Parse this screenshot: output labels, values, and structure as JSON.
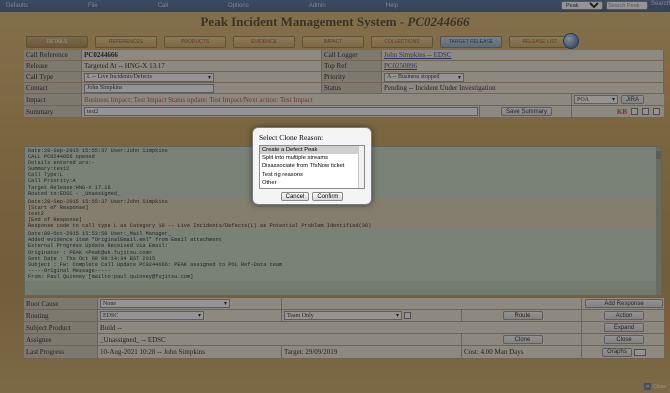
{
  "menubar": {
    "items": [
      "Defaults",
      "File",
      "Call",
      "Options",
      "Admin",
      "Help"
    ],
    "scope_value": "Peak",
    "search_placeholder": "Search Peak",
    "search_label": "Search"
  },
  "app": {
    "title": "Peak Incident Management System - ",
    "call_id": "PC0244666"
  },
  "tabs": [
    "DETAILS",
    "REFERENCES",
    "PRODUCTS",
    "EVIDENCE",
    "IMPACT",
    "COLLECTIONS",
    "TARGET RELEASE",
    "RELEASE LIST"
  ],
  "form": {
    "call_reference_label": "Call Reference",
    "call_reference": "PC0244666",
    "call_logger_label": "Call Logger",
    "call_logger": "John Simpkins -- EDSC",
    "release_label": "Release",
    "release": "Targeted At -- HNG-X 13.17",
    "top_ref_label": "Top Ref",
    "top_ref": "PC0250896",
    "call_type_label": "Call Type",
    "call_type": "L -- Live Incidents/Defects",
    "priority_label": "Priority",
    "priority": "A -- Business stopped",
    "contact_label": "Contact",
    "contact": "John Simpkins",
    "status_label": "Status",
    "status": "Pending -- Incident Under Investigation",
    "impact_label": "Impact",
    "impact": "Business Impact: Test Impact Status update: Test Impact/Next action: Test Impact",
    "impact_select": "POA",
    "jira_button": "JIRA",
    "summary_label": "Summary",
    "summary": "test2",
    "save_summary": "Save Summary",
    "kb_label": "KB"
  },
  "log": {
    "block1": [
      "Date:28-Sep-2015 15:55:37 User:John Simpkins",
      "CALL PC0244666 opened",
      "Details entered are:-",
      "Summary:test2",
      "Call Type:L",
      "Call Priority:A",
      "Target Release:HNG-X 17.16",
      "Routed to:EDSC - _Unassigned_"
    ],
    "block2": [
      "Date:28-Sep-2015 15:55:37 User:John Simpkins",
      "[Start of Response]",
      "test2",
      "[End of Response]",
      "Response code to call type L as Category 10 -- Live Incidents/Defects(L) as Potential Problem Identified(38)"
    ],
    "block3": [
      "Date:08-Oct-2015 15:53:50 User:_Mail Manager_",
      "Added evidence item \"OriginalEmail.eml\" from Email attachment",
      "External Progress Update Received via Email:",
      "Originator : PEAK <Peak@uk.fujitsu.com>",
      "Sent Date : Thu Oct 08 09:14:34 BST 2015",
      "Subject : Fw: Complete Call Update PC0244666: PEAK assigned to POL Ref-Data team",
      "",
      "",
      "-----Original Message-----",
      "From: Paul Quinney [mailto:paul.quinney@fujitsu.com]"
    ]
  },
  "bottom": {
    "root_cause_label": "Root Cause",
    "root_cause": "None",
    "routing_label": "Routing",
    "routing": "EDSC",
    "team": "Team Only",
    "route_button": "Route",
    "subject_product_label": "Subject Product",
    "subject_product": "Build --",
    "assignee_label": "Assignee",
    "assignee": "_Unassigned_ -- EDSC",
    "clone_button": "Clone",
    "last_progress_label": "Last Progress",
    "last_progress": "10-Aug-2021 10:28 -- John Simpkins",
    "target": "Target: 29/09/2019",
    "cost": "Cost: 4.00 Man Days",
    "graphs_button": "Graphs",
    "add_response": "Add Response",
    "action": "Action",
    "expand": "Expand",
    "close": "Close"
  },
  "modal": {
    "title": "Select Clone Reason:",
    "options": [
      "Create a Defect Peak",
      "Split into multiple streams",
      "Disassociate from TfsNow ticket",
      "Test rig reasons",
      "Other"
    ],
    "selected": "Create a Defect Peak",
    "cancel": "Cancel",
    "confirm": "Confirm"
  },
  "footer": {
    "close_label": "Close"
  }
}
